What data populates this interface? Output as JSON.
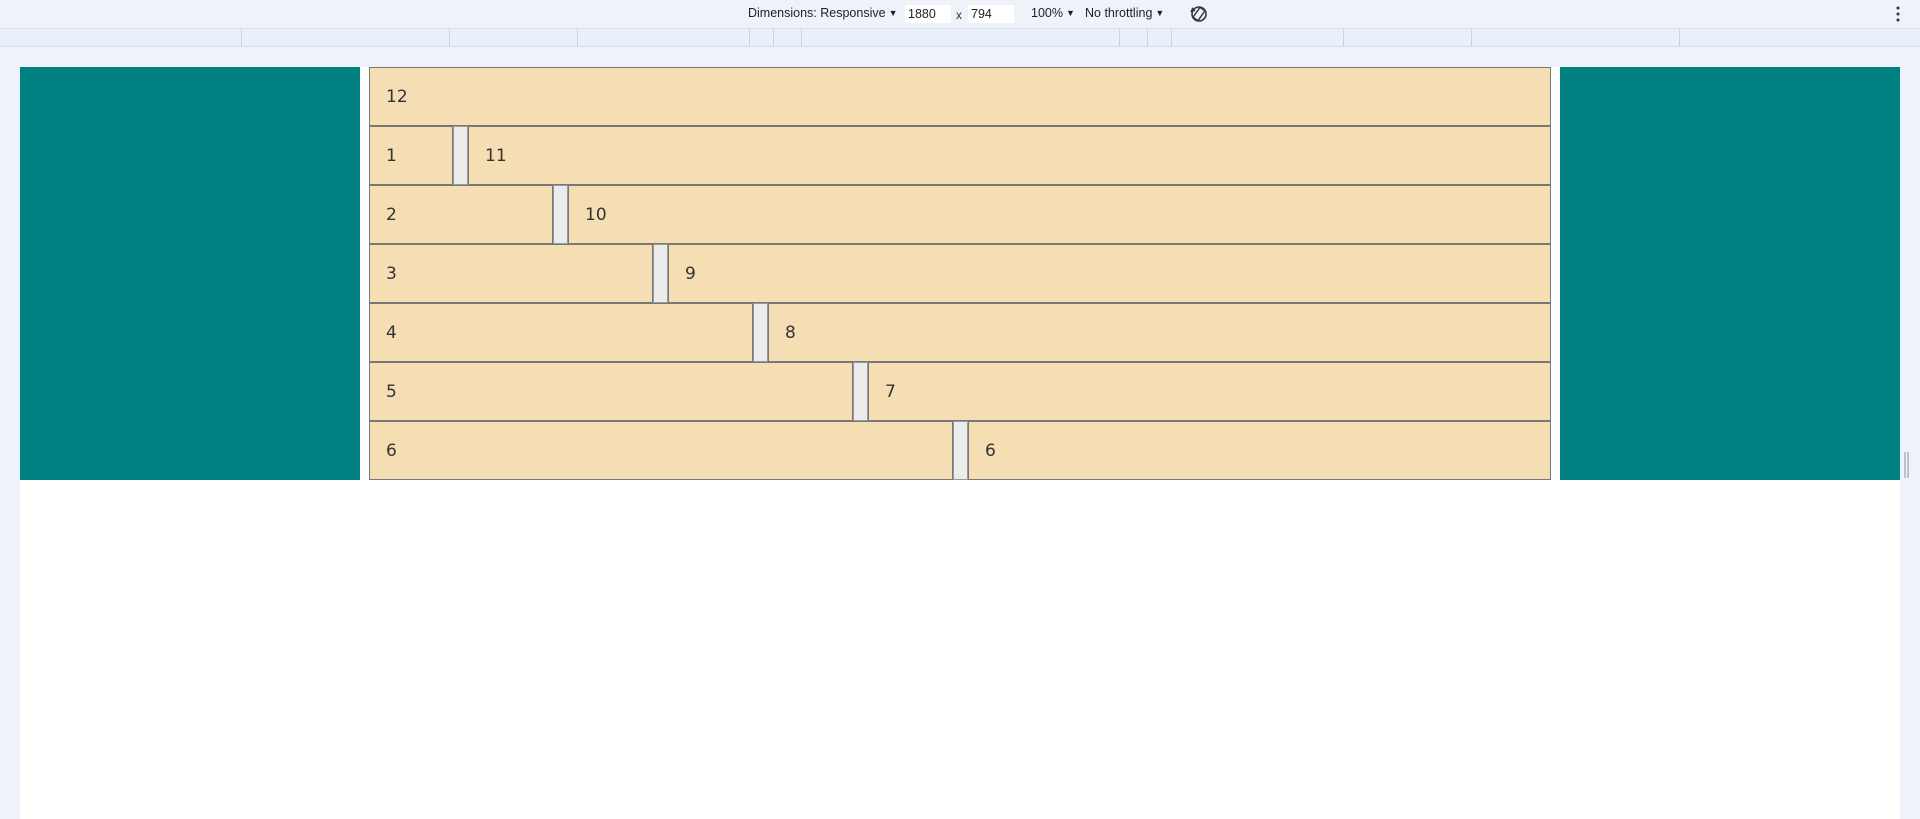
{
  "toolbar": {
    "dimensions_label": "Dimensions: Responsive",
    "width_value": "1880",
    "times": "x",
    "height_value": "794",
    "zoom_label": "100%",
    "throttle_label": "No throttling"
  },
  "grid": {
    "rows": [
      {
        "label": "12"
      },
      {
        "left": "1",
        "right": "11"
      },
      {
        "left": "2",
        "right": "10"
      },
      {
        "left": "3",
        "right": "9"
      },
      {
        "left": "4",
        "right": "8"
      },
      {
        "left": "5",
        "right": "7"
      },
      {
        "left": "6",
        "right": "6"
      }
    ]
  },
  "colors": {
    "side_panel": "#008080",
    "cell": "#f5deb3"
  }
}
